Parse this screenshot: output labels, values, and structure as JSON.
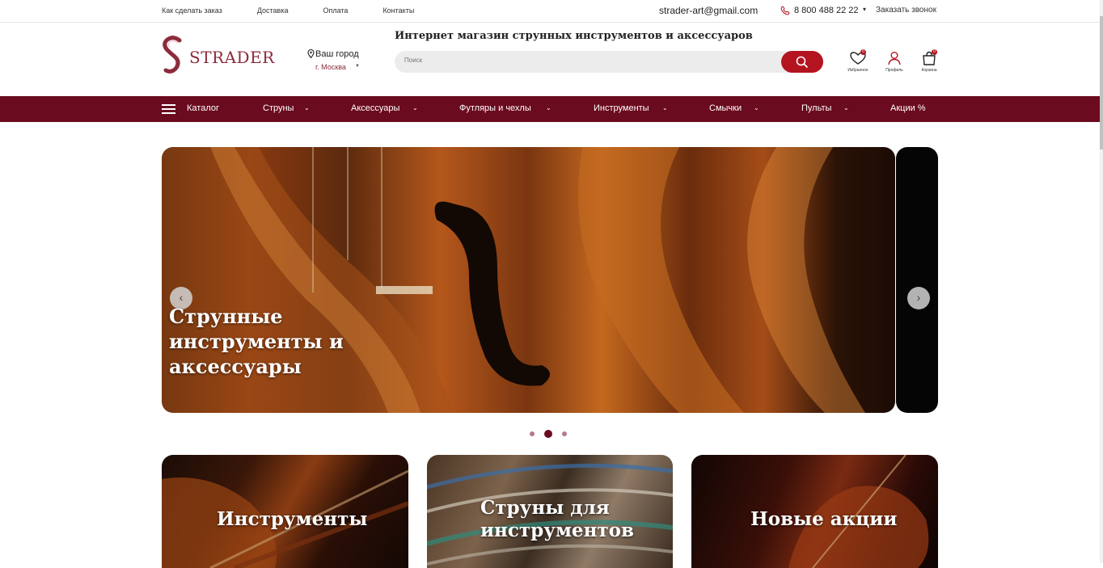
{
  "topbar": {
    "links": [
      "Как сделать заказ",
      "Доставка",
      "Оплата",
      "Контакты"
    ],
    "email": "strader-art@gmail.com",
    "phone": "8 800 488 22 22",
    "callback": "Заказать звонок"
  },
  "header": {
    "logo_text": "STRADER",
    "city_title": "Ваш город",
    "city_name": "г. Москва",
    "tagline": "Интернет магазин струнных инструментов и аксессуаров",
    "search_placeholder": "Поиск",
    "favorites_label": "Избранное",
    "favorites_count": "0",
    "profile_label": "Профиль",
    "cart_label": "Корзина",
    "cart_count": "0"
  },
  "nav": {
    "catalog": "Каталог",
    "items": [
      "Струны",
      "Аксессуары",
      "Футляры и чехлы",
      "Инструменты",
      "Смычки",
      "Пульты",
      "Акции %"
    ]
  },
  "hero": {
    "title": "Струнные инструменты и аксессуары",
    "slide_count": 3,
    "active_slide": 2
  },
  "cards": [
    {
      "title": "Инструменты"
    },
    {
      "title": "Струны для инструментов"
    },
    {
      "title": "Новые акции"
    }
  ],
  "colors": {
    "brand": "#6b0b1f",
    "accent": "#b3141f",
    "logo": "#8d2b3c"
  }
}
